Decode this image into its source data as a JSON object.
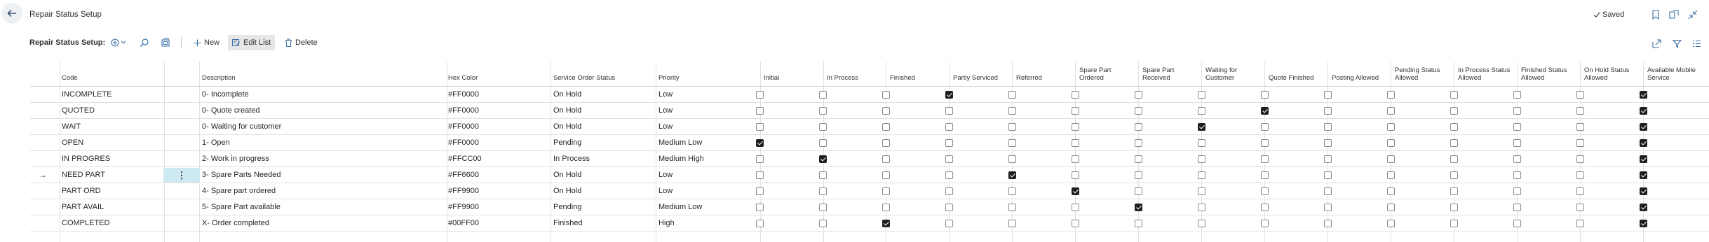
{
  "header": {
    "title": "Repair Status Setup",
    "saved_label": "Saved"
  },
  "toolbar": {
    "title": "Repair Status Setup:",
    "new_label": "New",
    "edit_list_label": "Edit List",
    "delete_label": "Delete"
  },
  "columns": {
    "code": "Code",
    "description": "Description",
    "hex_color": "Hex Color",
    "service_order_status": "Service Order Status",
    "priority": "Priority",
    "initial": "Initial",
    "in_process": "In Process",
    "finished": "Finished",
    "partly_serviced": "Partly Serviced",
    "referred": "Referred",
    "spare_part_ordered": [
      "Spare Part",
      "Ordered"
    ],
    "spare_part_received": [
      "Spare Part",
      "Received"
    ],
    "waiting_for_customer": [
      "Waiting for",
      "Customer"
    ],
    "quote_finished": "Quote Finished",
    "posting_allowed": "Posting Allowed",
    "pending_status_allowed": [
      "Pending Status",
      "Allowed"
    ],
    "in_process_status_allowed": [
      "In Process Status",
      "Allowed"
    ],
    "finished_status_allowed": [
      "Finished Status",
      "Allowed"
    ],
    "on_hold_status_allowed": [
      "On Hold Status",
      "Allowed"
    ],
    "available_mobile_service": [
      "Available Mobile",
      "Service"
    ]
  },
  "rows": [
    {
      "code": "INCOMPLETE",
      "description": "0- Incomplete",
      "hex": "#FF0000",
      "status": "On Hold",
      "priority": "Low",
      "checks": [
        0,
        0,
        0,
        1,
        0,
        0,
        0,
        0,
        0,
        0,
        0,
        0,
        0,
        0,
        1
      ]
    },
    {
      "code": "QUOTED",
      "description": "0- Quote created",
      "hex": "#FF0000",
      "status": "On Hold",
      "priority": "Low",
      "checks": [
        0,
        0,
        0,
        0,
        0,
        0,
        0,
        0,
        1,
        0,
        0,
        0,
        0,
        0,
        1
      ]
    },
    {
      "code": "WAIT",
      "description": "0- Waiting for customer",
      "hex": "#FF0000",
      "status": "On Hold",
      "priority": "Low",
      "checks": [
        0,
        0,
        0,
        0,
        0,
        0,
        0,
        1,
        0,
        0,
        0,
        0,
        0,
        0,
        1
      ]
    },
    {
      "code": "OPEN",
      "description": "1- Open",
      "hex": "#FF0000",
      "status": "Pending",
      "priority": "Medium Low",
      "checks": [
        1,
        0,
        0,
        0,
        0,
        0,
        0,
        0,
        0,
        0,
        0,
        0,
        0,
        0,
        1
      ]
    },
    {
      "code": "IN PROGRES",
      "description": "2- Work in progress",
      "hex": "#FFCC00",
      "status": "In Process",
      "priority": "Medium High",
      "checks": [
        0,
        1,
        0,
        0,
        0,
        0,
        0,
        0,
        0,
        0,
        0,
        0,
        0,
        0,
        1
      ]
    },
    {
      "code": "NEED PART",
      "description": "3- Spare Parts Needed",
      "hex": "#FF6600",
      "status": "On Hold",
      "priority": "Low",
      "checks": [
        0,
        0,
        0,
        0,
        1,
        0,
        0,
        0,
        0,
        0,
        0,
        0,
        0,
        0,
        1
      ],
      "selected": true
    },
    {
      "code": "PART ORD",
      "description": "4- Spare part ordered",
      "hex": "#FF9900",
      "status": "On Hold",
      "priority": "Low",
      "checks": [
        0,
        0,
        0,
        0,
        0,
        1,
        0,
        0,
        0,
        0,
        0,
        0,
        0,
        0,
        1
      ]
    },
    {
      "code": "PART AVAIL",
      "description": "5- Spare Part available",
      "hex": "#FF9900",
      "status": "Pending",
      "priority": "Medium Low",
      "checks": [
        0,
        0,
        0,
        0,
        0,
        0,
        1,
        0,
        0,
        0,
        0,
        0,
        0,
        0,
        1
      ]
    },
    {
      "code": "COMPLETED",
      "description": "X- Order completed",
      "hex": "#00FF00",
      "status": "Finished",
      "priority": "High",
      "checks": [
        0,
        0,
        1,
        0,
        0,
        0,
        0,
        0,
        0,
        0,
        0,
        0,
        0,
        0,
        1
      ]
    }
  ],
  "colors": {
    "accent": "#3a6ea5",
    "selected_row_menu": "#cdeaf3",
    "grid_line": "#e1e1e1"
  }
}
